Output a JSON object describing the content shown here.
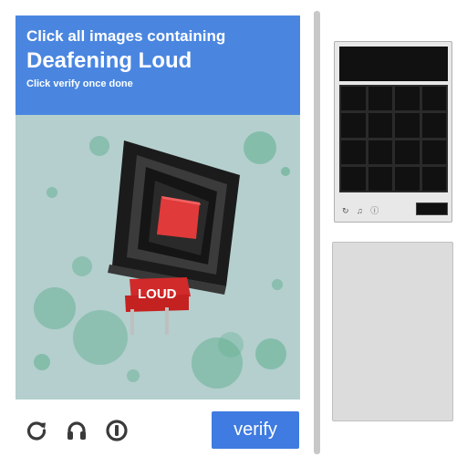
{
  "header": {
    "prompt": "Click all images containing",
    "target": "Deafening Loud",
    "instruction": "Click verify once done"
  },
  "image": {
    "sign_text": "LOUD",
    "background_color": "#b4cfce",
    "dot_color": "#5fae8e",
    "speaker_color": "#2a2a2a",
    "cone_color": "#e03a3a"
  },
  "controls": {
    "reload_icon": "reload-icon",
    "audio_icon": "headphones-icon",
    "info_icon": "info-icon",
    "verify_label": "verify"
  },
  "colors": {
    "accent": "#4a86e0",
    "button": "#3f7be0"
  },
  "thumbnail": {
    "icon_glyphs": "↻ ♫ ⓘ"
  }
}
